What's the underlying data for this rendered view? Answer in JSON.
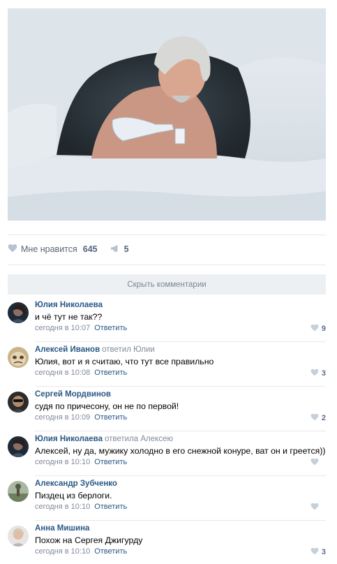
{
  "post": {
    "likes_label": "Мне нравится",
    "likes_count": "645",
    "shares_count": "5",
    "hide_comments_label": "Скрыть комментарии"
  },
  "comments": [
    {
      "author": "Юлия Николаева",
      "reply_to": "",
      "text": "и чё тут не так??",
      "time": "сегодня в 10:07",
      "reply_label": "Ответить",
      "likes": "9"
    },
    {
      "author": "Алексей Иванов",
      "reply_to": "ответил Юлии",
      "text": "Юлия, вот и я считаю, что тут все правильно",
      "time": "сегодня в 10:08",
      "reply_label": "Ответить",
      "likes": "3"
    },
    {
      "author": "Сергей Мордвинов",
      "reply_to": "",
      "text": "судя по причесону, он не по первой!",
      "time": "сегодня в 10:09",
      "reply_label": "Ответить",
      "likes": "2"
    },
    {
      "author": "Юлия Николаева",
      "reply_to": "ответила Алексею",
      "text": "Алексей, ну да, мужику холодно в его снежной конуре, ват он и греется))",
      "time": "сегодня в 10:10",
      "reply_label": "Ответить",
      "likes": ""
    },
    {
      "author": "Александр Зубченко",
      "reply_to": "",
      "text": "Пиздец из берлоги.",
      "time": "сегодня в 10:10",
      "reply_label": "Ответить",
      "likes": ""
    },
    {
      "author": "Анна Мишина",
      "reply_to": "",
      "text": "Похож на Сергея Джигурду",
      "time": "сегодня в 10:10",
      "reply_label": "Ответить",
      "likes": "3"
    }
  ],
  "icons": {
    "like": "heart-icon",
    "share": "megaphone-icon",
    "comment_like": "heart-icon"
  },
  "colors": {
    "link": "#2a5885",
    "muted": "#828a99",
    "divider": "#e7e8ec",
    "button_bg": "#edf0f3"
  }
}
